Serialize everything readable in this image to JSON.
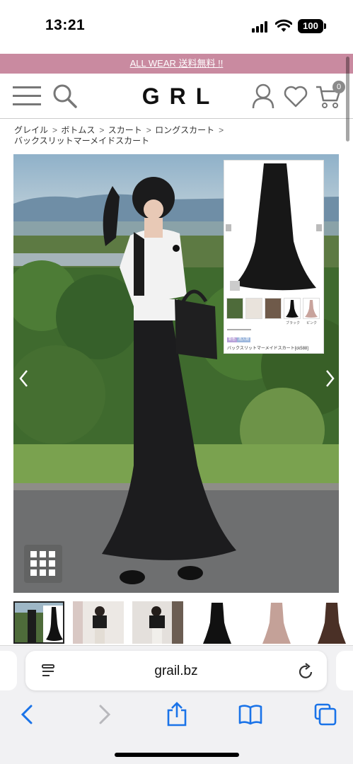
{
  "status_bar": {
    "time": "13:21",
    "battery": "100"
  },
  "promo_banner": {
    "text": "ALL WEAR 送料無料 !!"
  },
  "header": {
    "logo": "GRL",
    "cart_count": "0"
  },
  "breadcrumb": {
    "items": [
      "グレイル",
      "ボトムス",
      "スカート",
      "ロングスカート"
    ],
    "current": "バックスリットマーメイドスカート"
  },
  "product_inset": {
    "caption": "バックスリットマーメイドスカート[ck588]",
    "tags": [
      "新色",
      "再入荷"
    ],
    "thumb_labels": [
      "ブラック",
      "ピンク"
    ]
  },
  "browser": {
    "url": "grail.bz"
  },
  "icons": {
    "menu": "hamburger-icon",
    "search": "search-icon",
    "account": "user-icon",
    "favorite": "heart-icon",
    "cart": "cart-icon",
    "back": "chevron-left-icon",
    "forward": "chevron-right-icon",
    "share": "share-icon",
    "bookmarks": "book-icon",
    "tabs": "tabs-icon",
    "reload": "reload-icon",
    "reader": "reader-icon",
    "grid": "grid-icon"
  },
  "colors": {
    "promo_bg": "#c98aa0",
    "safari_bg": "#f1f1f3",
    "link_blue": "#1a73e8"
  }
}
